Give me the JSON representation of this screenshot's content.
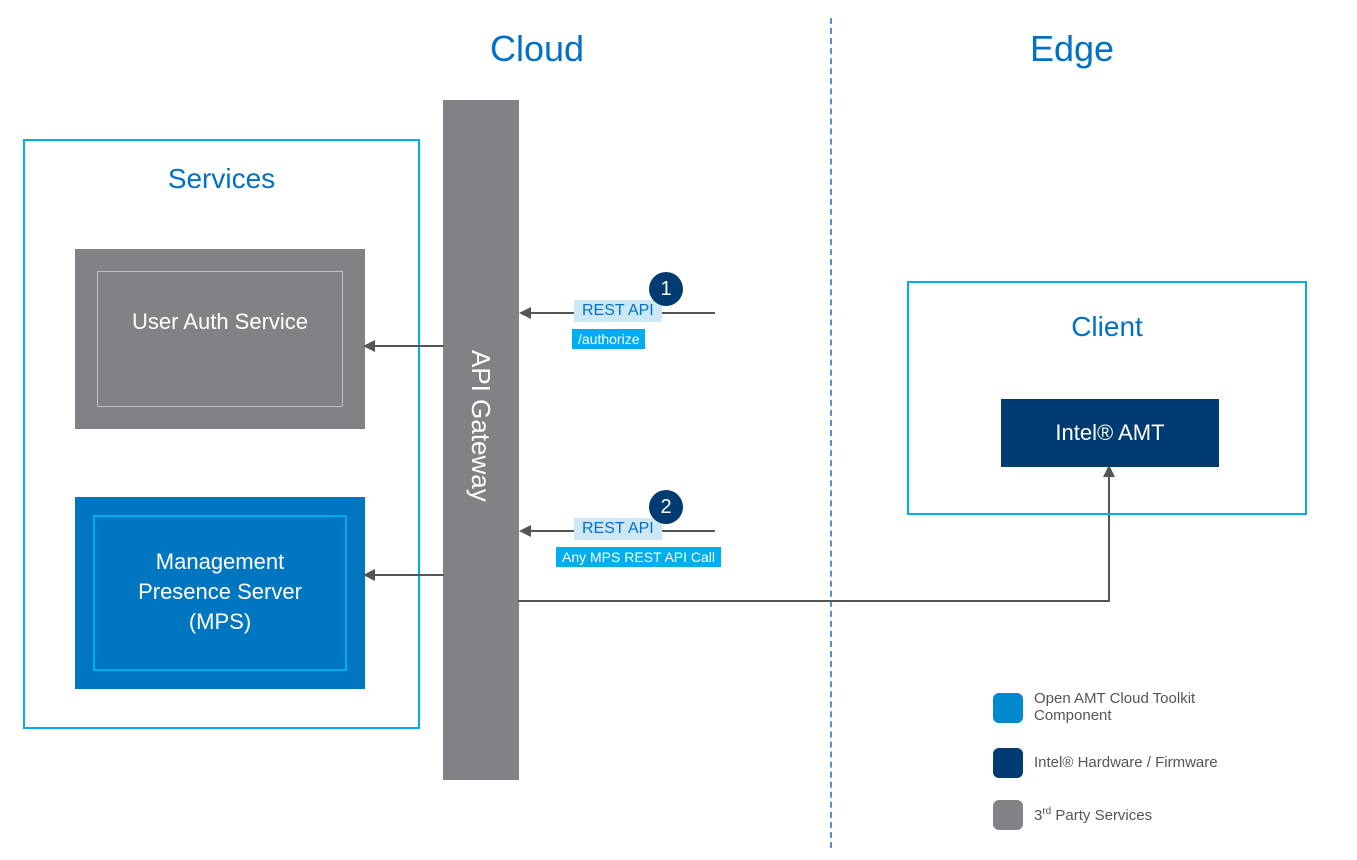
{
  "titles": {
    "cloud": "Cloud",
    "edge": "Edge"
  },
  "services": {
    "label": "Services",
    "auth": "User Auth Service",
    "mps_l1": "Management",
    "mps_l2": "Presence Server",
    "mps_l3": "(MPS)"
  },
  "gateway": "API Gateway",
  "rest": {
    "label1": "REST API",
    "badge1": "1",
    "tag1": "/authorize",
    "label2": "REST API",
    "badge2": "2",
    "tag2": "Any MPS REST API Call"
  },
  "client": {
    "label": "Client",
    "amt": "Intel® AMT"
  },
  "legend": {
    "item1": "Open AMT Cloud Toolkit Component",
    "item2": "Intel® Hardware / Firmware",
    "item3_pre": "3",
    "item3_sup": "rd",
    "item3_post": " Party Services"
  },
  "chart_data": {
    "type": "diagram",
    "title": "Cloud / Edge architecture with API Gateway mediating REST calls to Services and MPS, which communicates with Intel AMT on the client",
    "regions": [
      "Cloud",
      "Edge"
    ],
    "nodes": [
      {
        "id": "services",
        "label": "Services",
        "region": "Cloud",
        "children": [
          "user-auth",
          "mps"
        ]
      },
      {
        "id": "user-auth",
        "label": "User Auth Service",
        "category": "3rd Party Services"
      },
      {
        "id": "mps",
        "label": "Management Presence Server (MPS)",
        "category": "Open AMT Cloud Toolkit Component"
      },
      {
        "id": "gateway",
        "label": "API Gateway",
        "region": "Cloud",
        "category": "3rd Party Services"
      },
      {
        "id": "client",
        "label": "Client",
        "region": "Edge",
        "children": [
          "intel-amt"
        ]
      },
      {
        "id": "intel-amt",
        "label": "Intel® AMT",
        "category": "Intel® Hardware / Firmware"
      }
    ],
    "edges": [
      {
        "from": "external",
        "to": "gateway",
        "step": 1,
        "label": "REST API",
        "detail": "/authorize"
      },
      {
        "from": "gateway",
        "to": "user-auth"
      },
      {
        "from": "external",
        "to": "gateway",
        "step": 2,
        "label": "REST API",
        "detail": "Any MPS REST API Call"
      },
      {
        "from": "gateway",
        "to": "mps"
      },
      {
        "from": "mps",
        "to": "intel-amt"
      }
    ],
    "legend": [
      {
        "color": "#0088cf",
        "label": "Open AMT Cloud Toolkit Component"
      },
      {
        "color": "#003c71",
        "label": "Intel® Hardware / Firmware"
      },
      {
        "color": "#808285",
        "label": "3rd Party Services"
      }
    ]
  }
}
